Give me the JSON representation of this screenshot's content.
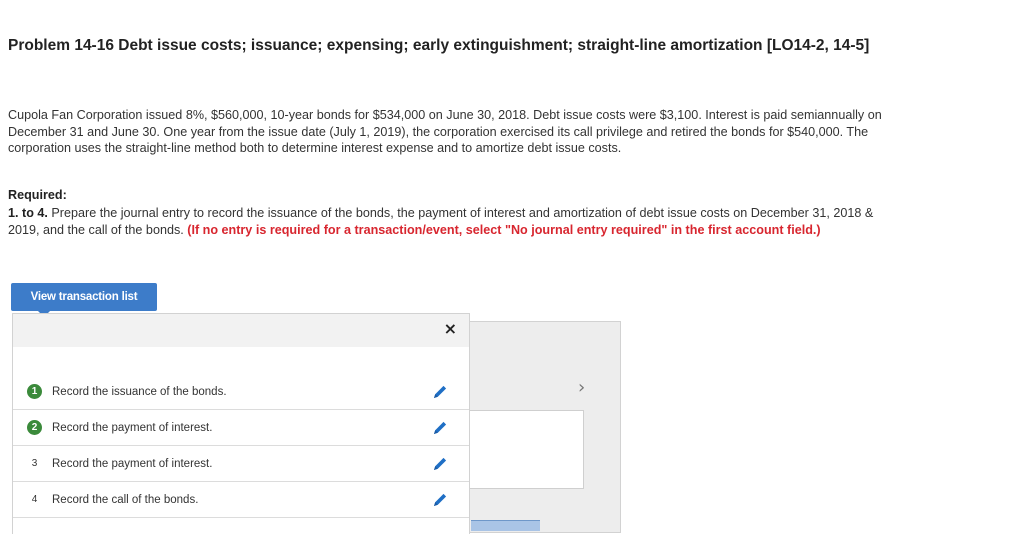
{
  "problem": {
    "title": "Problem 14-16 Debt issue costs; issuance; expensing; early extinguishment; straight-line amortization [LO14-2, 14-5]",
    "body": "Cupola Fan Corporation issued 8%, $560,000, 10-year bonds for $534,000 on June 30, 2018. Debt issue costs were $3,100. Interest is paid semiannually on December 31 and June 30. One year from the issue date (July 1, 2019), the corporation exercised its call privilege and retired the bonds for $540,000. The corporation uses the straight-line method both to determine interest expense and to amortize debt issue costs."
  },
  "required": {
    "label": "Required:",
    "item_number": "1. to 4.",
    "instruction": "Prepare the journal entry to record the issuance of the bonds, the payment of interest and amortization of debt issue costs on December 31, 2018 & 2019, and the call of the bonds.",
    "note": "(If no entry is required for a transaction/event, select \"No journal entry required\" in the first account field.)"
  },
  "view_button_label": "View transaction list",
  "close_symbol": "×",
  "next_symbol": "›",
  "transactions": [
    {
      "number": "1",
      "label": "Record the issuance of the bonds.",
      "completed": true
    },
    {
      "number": "2",
      "label": "Record the payment of interest.",
      "completed": true
    },
    {
      "number": "3",
      "label": "Record the payment of interest.",
      "completed": false
    },
    {
      "number": "4",
      "label": "Record the call of the bonds.",
      "completed": false
    }
  ],
  "colors": {
    "accent_blue": "#3d7cc9",
    "note_red": "#d8262f",
    "completed_green": "#3b8a3b"
  }
}
